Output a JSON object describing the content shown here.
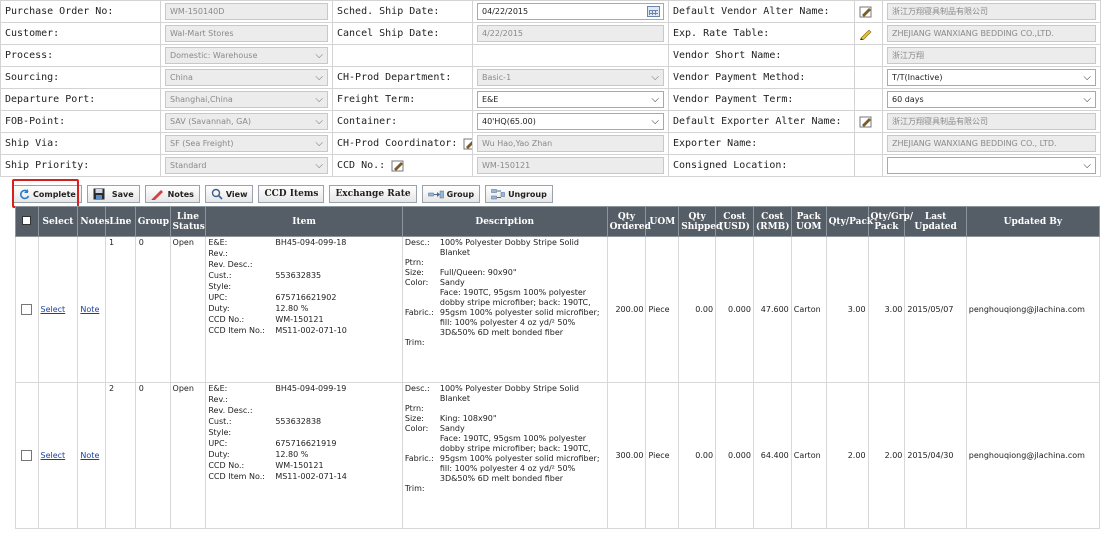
{
  "form": {
    "po_no_label": "Purchase Order No:",
    "po_no": "WM-150140D",
    "customer_label": "Customer:",
    "customer": "Wal-Mart Stores",
    "process_label": "Process:",
    "process": "Domestic: Warehouse",
    "sourcing_label": "Sourcing:",
    "sourcing": "China",
    "departure_label": "Departure Port:",
    "departure": "Shanghai,China",
    "fob_label": "FOB-Point:",
    "fob": "SAV (Savannah, GA)",
    "ship_via_label": "Ship Via:",
    "ship_via": "SF (Sea Freight)",
    "priority_label": "Ship Priority:",
    "priority": "Standard",
    "sched_label": "Sched. Ship Date:",
    "sched": "04/22/2015",
    "cancel_label": "Cancel Ship Date:",
    "cancel": "4/22/2015",
    "chprod_dept_label": "CH-Prod Department:",
    "chprod_dept": "Basic-1",
    "freight_label": "Freight Term:",
    "freight": "E&E",
    "container_label": "Container:",
    "container": "40'HQ(65.00)",
    "coord_label": "CH-Prod Coordinator:",
    "coord": "Wu Hao,Yao Zhan",
    "ccd_label": "CCD No.:",
    "ccd": "WM-150121",
    "def_vendor_label": "Default Vendor Alter Name:",
    "def_vendor": "浙江万翔寝具制品有限公司",
    "exp_rate_label": "Exp. Rate Table:",
    "exp_rate": "ZHEJIANG WANXIANG BEDDING CO.,LTD.",
    "vendor_short_label": "Vendor Short Name:",
    "vendor_short": "浙江万翔",
    "vendor_pay_method_label": "Vendor Payment Method:",
    "vendor_pay_method": "T/T(Inactive)",
    "vendor_pay_term_label": "Vendor Payment Term:",
    "vendor_pay_term": "60 days",
    "def_exporter_label": "Default Exporter Alter Name:",
    "def_exporter": "浙江万翔寝具制品有限公司",
    "exporter_label": "Exporter Name:",
    "exporter": "ZHEJIANG WANXIANG BEDDING CO., LTD.",
    "consigned_label": "Consigned Location:",
    "consigned": ""
  },
  "toolbar": {
    "complete": "Complete",
    "save": "Save",
    "notes": "Notes",
    "view": "View",
    "ccd_items": "CCD Items",
    "exchange_rate": "Exchange Rate",
    "group": "Group",
    "ungroup": "Ungroup"
  },
  "grid": {
    "headers": {
      "select": "Select",
      "notes": "Notes",
      "line": "Line",
      "group": "Group",
      "line_status_1": "Line",
      "line_status_2": "Status",
      "item": "Item",
      "description": "Description",
      "qty_ordered_1": "Qty",
      "qty_ordered_2": "Ordered",
      "uom": "UOM",
      "qty_shipped_1": "Qty",
      "qty_shipped_2": "Shipped",
      "cost_usd_1": "Cost",
      "cost_usd_2": "(USD)",
      "cost_rmb_1": "Cost",
      "cost_rmb_2": "(RMB)",
      "pack_uom_1": "Pack",
      "pack_uom_2": "UOM",
      "qty_pack": "Qty/Pack",
      "qty_grp_1": "Qty/Grp/",
      "qty_grp_2": "Pack",
      "last_updated_1": "Last",
      "last_updated_2": "Updated",
      "updated_by": "Updated By"
    },
    "item_labels": {
      "ee": "E&E:",
      "rev": "Rev.:",
      "rev_desc": "Rev. Desc.:",
      "cust": "Cust.:",
      "style": "Style:",
      "upc": "UPC:",
      "duty": "Duty:",
      "ccd_no": "CCD No.:",
      "ccd_item": "CCD Item No.:"
    },
    "desc_labels": {
      "desc": "Desc.:",
      "ptrn": "Ptrn:",
      "size": "Size:",
      "color": "Color:",
      "fabric": "Fabric.:",
      "trim": "Trim:"
    },
    "rows": [
      {
        "select": "Select",
        "notes": "Note",
        "line": "1",
        "group": "0",
        "status": "Open",
        "ee": "BH45-094-099-18",
        "rev": "",
        "rev_desc": "",
        "cust": "553632835",
        "style": "",
        "upc": "675716621902",
        "duty": "12.80 %",
        "ccd_no": "WM-150121",
        "ccd_item": "MS11-002-071-10",
        "desc": "100% Polyester Dobby Stripe Solid Blanket",
        "ptrn": "",
        "size": "Full/Queen: 90x90\"",
        "color": "Sandy",
        "fabric": "Face: 190TC, 95gsm 100% polyester dobby stripe microfiber; back: 190TC, 95gsm 100% polyester solid microfiber; fill: 100% polyester 4 oz yd/² 50% 3D&50% 6D melt bonded fiber",
        "trim": "",
        "qty_ordered": "200.00",
        "uom": "Piece",
        "qty_shipped": "0.00",
        "cost_usd": "0.000",
        "cost_rmb": "47.600",
        "pack_uom": "Carton",
        "qty_pack": "3.00",
        "qty_grp": "3.00",
        "last_updated": "2015/05/07",
        "updated_by": "penghouqiong@jlachina.com"
      },
      {
        "select": "Select",
        "notes": "Note",
        "line": "2",
        "group": "0",
        "status": "Open",
        "ee": "BH45-094-099-19",
        "rev": "",
        "rev_desc": "",
        "cust": "553632838",
        "style": "",
        "upc": "675716621919",
        "duty": "12.80 %",
        "ccd_no": "WM-150121",
        "ccd_item": "MS11-002-071-14",
        "desc": "100% Polyester Dobby Stripe Solid Blanket",
        "ptrn": "",
        "size": "King: 108x90\"",
        "color": "Sandy",
        "fabric": "Face: 190TC, 95gsm 100% polyester dobby stripe microfiber; back: 190TC, 95gsm 100% polyester solid microfiber; fill: 100% polyester 4 oz yd/² 50% 3D&50% 6D melt bonded fiber",
        "trim": "",
        "qty_ordered": "300.00",
        "uom": "Piece",
        "qty_shipped": "0.00",
        "cost_usd": "0.000",
        "cost_rmb": "64.400",
        "pack_uom": "Carton",
        "qty_pack": "2.00",
        "qty_grp": "2.00",
        "last_updated": "2015/04/30",
        "updated_by": "penghouqiong@jlachina.com"
      }
    ]
  },
  "colors": {
    "header_bg": "#555d66",
    "link": "#1a3fa6",
    "highlight": "#d61f1f"
  }
}
